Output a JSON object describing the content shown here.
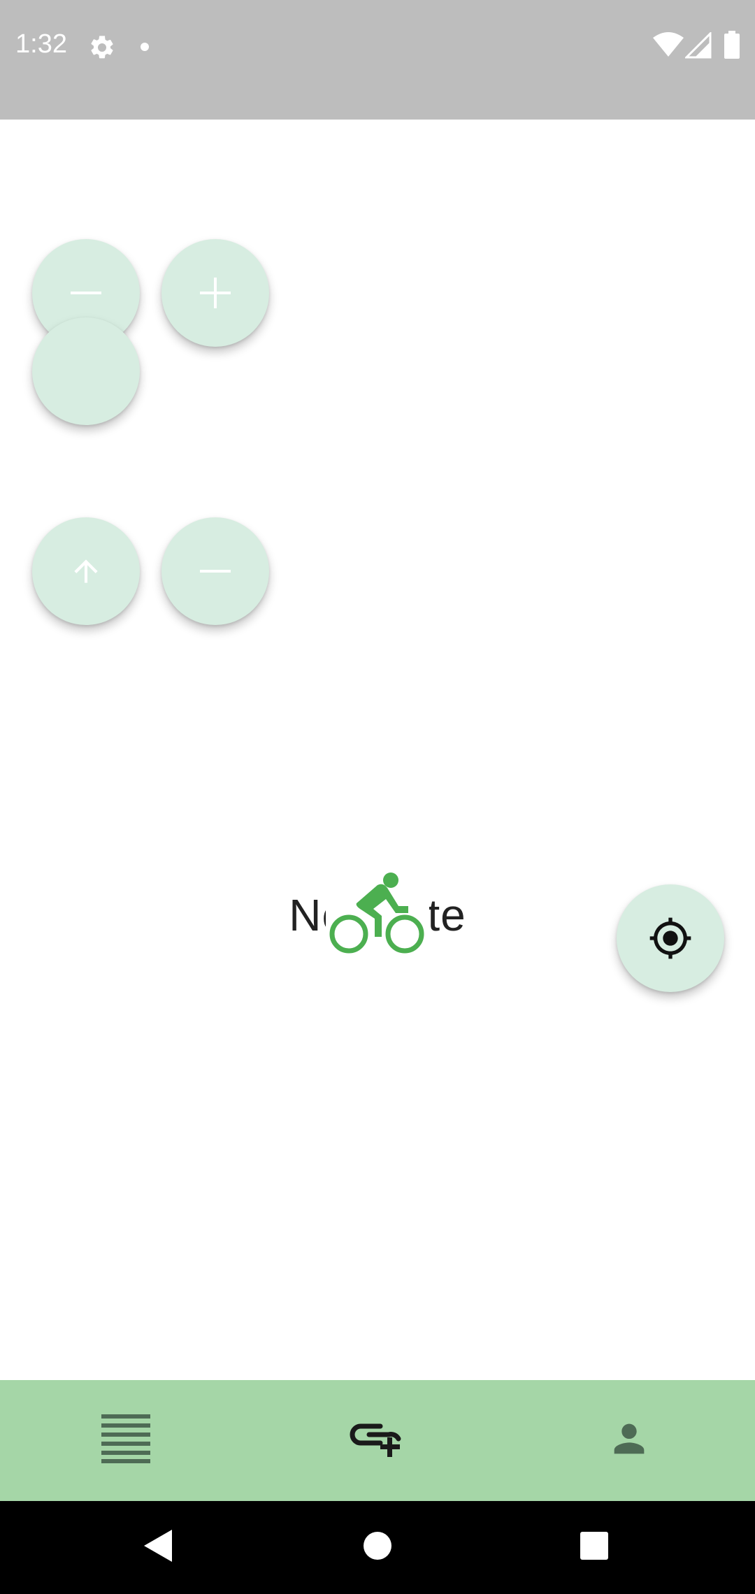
{
  "status_bar": {
    "time": "1:32",
    "icons": [
      "settings-gear-icon",
      "notification-dot-icon",
      "wifi-icon",
      "cell-signal-icon",
      "battery-icon"
    ]
  },
  "map": {
    "empty_message": "No route",
    "center_icon": "bicycle-icon",
    "accent_color": "#4caf50",
    "fab_color": "#d7ede1",
    "buttons": [
      {
        "name": "zoom-out-button",
        "icon": "minus-icon"
      },
      {
        "name": "zoom-in-button",
        "icon": "plus-icon"
      },
      {
        "name": "blank-fab-button",
        "icon": ""
      },
      {
        "name": "upload-button",
        "icon": "arrow-up-icon"
      },
      {
        "name": "remove-button",
        "icon": "minus-icon"
      },
      {
        "name": "my-location-button",
        "icon": "gps-crosshair-icon"
      }
    ]
  },
  "bottom_nav": {
    "background": "#a5d6a7",
    "items": [
      {
        "name": "list",
        "icon": "list-lines-icon"
      },
      {
        "name": "add-link",
        "icon": "link-plus-icon"
      },
      {
        "name": "profile",
        "icon": "person-icon"
      }
    ]
  },
  "system_nav": {
    "buttons": [
      "back-triangle-icon",
      "home-circle-icon",
      "recents-square-icon"
    ]
  }
}
